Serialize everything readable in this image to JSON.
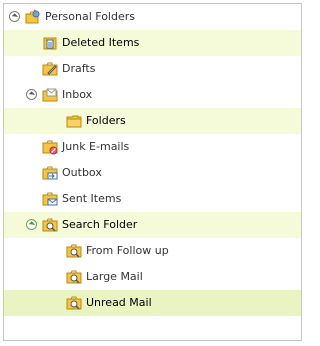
{
  "tree": {
    "items": [
      {
        "label": "Personal Folders"
      },
      {
        "label": "Deleted Items"
      },
      {
        "label": "Drafts"
      },
      {
        "label": "Inbox"
      },
      {
        "label": "Folders"
      },
      {
        "label": "Junk E-mails"
      },
      {
        "label": "Outbox"
      },
      {
        "label": "Sent Items"
      },
      {
        "label": "Search Folder"
      },
      {
        "label": "From Follow up"
      },
      {
        "label": "Large Mail"
      },
      {
        "label": "Unread Mail"
      }
    ],
    "colors": {
      "hover_bg": "#f5fad9",
      "selected_bg": "#eaf3c2",
      "text": "#333333",
      "folder_yellow": "#f4c542",
      "toggle_green": "#6aa84f"
    }
  }
}
